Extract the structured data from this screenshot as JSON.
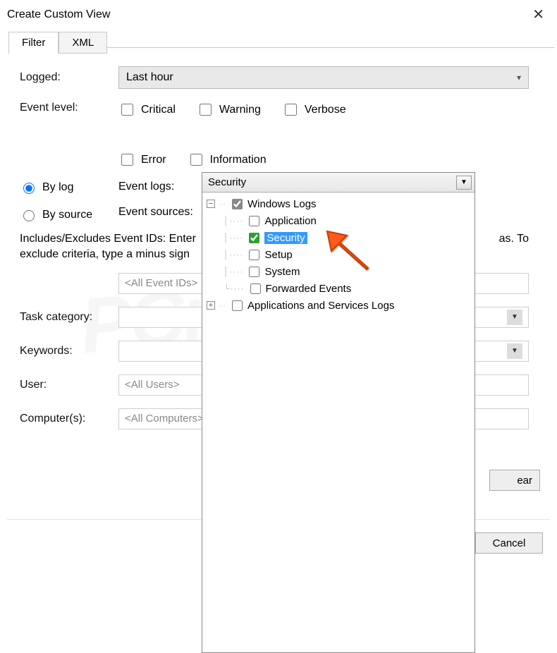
{
  "window": {
    "title": "Create Custom View"
  },
  "tabs": {
    "filter": "Filter",
    "xml": "XML"
  },
  "labels": {
    "logged": "Logged:",
    "eventlevel": "Event level:",
    "bylog": "By log",
    "bysource": "By source",
    "eventlogs": "Event logs:",
    "eventsources": "Event sources:",
    "includes_line1": "Includes/Excludes Event IDs: Enter",
    "includes_line2": "exclude criteria, type a minus sign",
    "includes_tail": "as. To",
    "taskcat": "Task category:",
    "keywords": "Keywords:",
    "user": "User:",
    "computers": "Computer(s):"
  },
  "values": {
    "logged": "Last hour",
    "eventlogs_selected": "Security",
    "allids": "<All Event IDs>",
    "allusers": "<All Users>",
    "allcomputers": "<All Computers>"
  },
  "levels": {
    "critical": "Critical",
    "warning": "Warning",
    "verbose": "Verbose",
    "error": "Error",
    "information": "Information"
  },
  "tree": {
    "root1": "Windows Logs",
    "app": "Application",
    "security": "Security",
    "setup": "Setup",
    "system": "System",
    "forwarded": "Forwarded Events",
    "root2": "Applications and Services Logs"
  },
  "buttons": {
    "clear": "ear",
    "cancel": "Cancel"
  },
  "watermark": "PCrisk.com"
}
